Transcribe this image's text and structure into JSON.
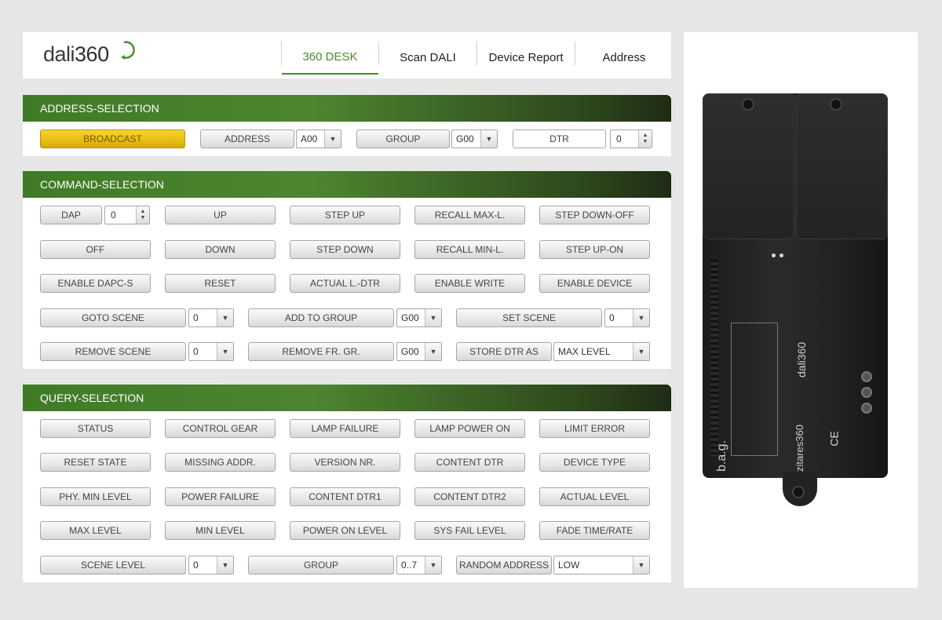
{
  "logo": {
    "text_a": "dali",
    "text_b": "360"
  },
  "nav": {
    "items": [
      "360 DESK",
      "Scan DALI",
      "Device Report",
      "Address"
    ]
  },
  "address_selection": {
    "title": "ADDRESS-SELECTION",
    "broadcast": "BROADCAST",
    "address": "ADDRESS",
    "address_value": "A00",
    "group": "GROUP",
    "group_value": "G00",
    "dtr": "DTR",
    "dtr_value": "0"
  },
  "command_selection": {
    "title": "COMMAND-SELECTION",
    "dap": "DAP",
    "dap_value": "0",
    "buttons": [
      [
        "UP",
        "STEP UP",
        "RECALL MAX-L.",
        "STEP DOWN-OFF"
      ],
      [
        "OFF",
        "DOWN",
        "STEP DOWN",
        "RECALL MIN-L.",
        "STEP UP-ON"
      ],
      [
        "ENABLE DAPC-S",
        "RESET",
        "ACTUAL L.-DTR",
        "ENABLE WRITE",
        "ENABLE DEVICE"
      ]
    ],
    "goto_scene": "GOTO SCENE",
    "goto_scene_value": "0",
    "add_to_group": "ADD TO GROUP",
    "add_to_group_value": "G00",
    "set_scene": "SET SCENE",
    "set_scene_value": "0",
    "remove_scene": "REMOVE SCENE",
    "remove_scene_value": "0",
    "remove_fr_gr": "REMOVE FR. GR.",
    "remove_fr_gr_value": "G00",
    "store_dtr_as": "STORE DTR AS",
    "store_dtr_as_value": "MAX LEVEL"
  },
  "query_selection": {
    "title": "QUERY-SELECTION",
    "buttons": [
      [
        "STATUS",
        "CONTROL GEAR",
        "LAMP FAILURE",
        "LAMP POWER ON",
        "LIMIT ERROR"
      ],
      [
        "RESET STATE",
        "MISSING ADDR.",
        "VERSION NR.",
        "CONTENT DTR",
        "DEVICE TYPE"
      ],
      [
        "PHY. MIN LEVEL",
        "POWER FAILURE",
        "CONTENT DTR1",
        "CONTENT DTR2",
        "ACTUAL LEVEL"
      ],
      [
        "MAX LEVEL",
        "MIN LEVEL",
        "POWER ON LEVEL",
        "SYS FAIL LEVEL",
        "FADE TIME/RATE"
      ]
    ],
    "scene_level": "SCENE LEVEL",
    "scene_level_value": "0",
    "group": "GROUP",
    "group_value": "0..7",
    "random_address": "RANDOM ADDRESS",
    "random_address_value": "LOW"
  },
  "device": {
    "brand": "b.a.g.",
    "model_brand": "dali360",
    "zi_brand": "zitares360",
    "ce": "CE"
  },
  "colors": {
    "accent": "#4b8a2f",
    "broadcast": "#eabe12",
    "bar_dark": "#1f2c14"
  }
}
